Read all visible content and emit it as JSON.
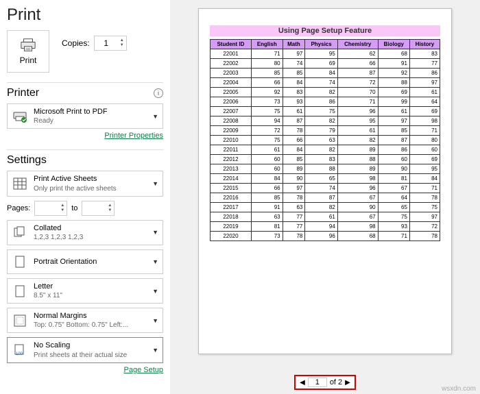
{
  "title": "Print",
  "copies_label": "Copies:",
  "copies_value": "1",
  "print_label": "Print",
  "printer_label": "Printer",
  "printer_name": "Microsoft Print to PDF",
  "printer_status": "Ready",
  "printer_props": "Printer Properties",
  "settings_label": "Settings",
  "active_sheets": "Print Active Sheets",
  "active_sheets_sub": "Only print the active sheets",
  "pages_label": "Pages:",
  "to_label": "to",
  "collated": "Collated",
  "collated_sub": "1,2,3   1,2,3   1,2,3",
  "orientation": "Portrait Orientation",
  "paper": "Letter",
  "paper_sub": "8.5\" x 11\"",
  "margins": "Normal Margins",
  "margins_sub": "Top: 0.75\"  Bottom: 0.75\"  Left:...",
  "scaling": "No Scaling",
  "scaling_sub": "Print sheets at their actual size",
  "page_setup": "Page Setup",
  "banner": "Using Page Setup Feature",
  "headers": [
    "Student ID",
    "English",
    "Math",
    "Physics",
    "Chemistry",
    "Biology",
    "History"
  ],
  "rows": [
    [
      "22001",
      "71",
      "97",
      "95",
      "62",
      "68",
      "83"
    ],
    [
      "22002",
      "80",
      "74",
      "69",
      "66",
      "91",
      "77"
    ],
    [
      "22003",
      "85",
      "85",
      "84",
      "87",
      "92",
      "86"
    ],
    [
      "22004",
      "66",
      "84",
      "74",
      "72",
      "88",
      "97"
    ],
    [
      "22005",
      "92",
      "83",
      "82",
      "70",
      "69",
      "61"
    ],
    [
      "22006",
      "73",
      "93",
      "86",
      "71",
      "99",
      "64"
    ],
    [
      "22007",
      "75",
      "61",
      "75",
      "96",
      "61",
      "69"
    ],
    [
      "22008",
      "94",
      "87",
      "82",
      "95",
      "97",
      "98"
    ],
    [
      "22009",
      "72",
      "78",
      "79",
      "61",
      "85",
      "71"
    ],
    [
      "22010",
      "75",
      "66",
      "63",
      "82",
      "87",
      "80"
    ],
    [
      "22011",
      "61",
      "84",
      "82",
      "89",
      "86",
      "60"
    ],
    [
      "22012",
      "60",
      "85",
      "83",
      "88",
      "60",
      "69"
    ],
    [
      "22013",
      "60",
      "89",
      "88",
      "89",
      "90",
      "95"
    ],
    [
      "22014",
      "84",
      "90",
      "65",
      "98",
      "81",
      "84"
    ],
    [
      "22015",
      "66",
      "97",
      "74",
      "96",
      "67",
      "71"
    ],
    [
      "22016",
      "85",
      "78",
      "87",
      "67",
      "64",
      "78"
    ],
    [
      "22017",
      "91",
      "63",
      "82",
      "90",
      "65",
      "75"
    ],
    [
      "22018",
      "63",
      "77",
      "61",
      "67",
      "75",
      "97"
    ],
    [
      "22019",
      "81",
      "77",
      "94",
      "98",
      "93",
      "72"
    ],
    [
      "22020",
      "73",
      "78",
      "96",
      "68",
      "71",
      "78"
    ]
  ],
  "pager_current": "1",
  "pager_of": "of 2",
  "watermark": "wsxdn.com"
}
